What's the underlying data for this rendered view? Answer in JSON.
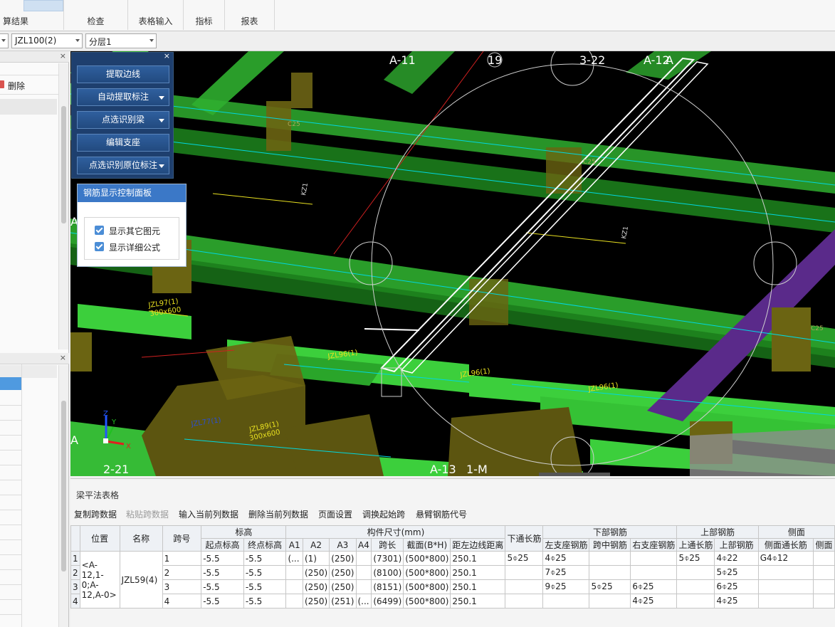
{
  "ribbon": {
    "groups": [
      {
        "label": "算结果",
        "highlight": true
      },
      {
        "label": "检查"
      },
      {
        "label": "表格输入"
      },
      {
        "label": "指标"
      },
      {
        "label": "报表"
      }
    ]
  },
  "selectors": {
    "first_value": "",
    "component": "JZL100(2)",
    "layer": "分层1"
  },
  "left_panel": {
    "close_label": "×",
    "delete_label": "删除"
  },
  "viewport_labels": {
    "a11": "A-11",
    "n19": "19",
    "n322": "3-22",
    "a12": "A-12",
    "a_right": "A",
    "a_left1": "A",
    "a_left2": "A",
    "n221": "2-21",
    "a13": "A-13",
    "m1": "1-M",
    "jzl97": "JZL97(1)",
    "jzl96a": "JZL96(1)",
    "jzl96b": "JZL96(1)",
    "jzl96c": "JZL96(1)",
    "jzl89": "JZL89(1)",
    "jzl77": "JZL77(1)",
    "dim": "300x600",
    "dim2": "300x600",
    "kz": "KZ1",
    "c25": "C25",
    "axis_x": "X",
    "axis_y": "Y",
    "axis_z": "Z"
  },
  "tool_panel": {
    "close_label": "×",
    "buttons": [
      {
        "label": "提取边线",
        "dropdown": false
      },
      {
        "label": "自动提取标注",
        "dropdown": true
      },
      {
        "label": "点选识别梁",
        "dropdown": true
      },
      {
        "label": "编辑支座",
        "dropdown": false
      },
      {
        "label": "点选识别原位标注",
        "dropdown": true
      }
    ]
  },
  "rebar_panel": {
    "title": "钢筋显示控制面板",
    "options": [
      {
        "label": "显示其它图元",
        "checked": true
      },
      {
        "label": "显示详细公式",
        "checked": true
      }
    ]
  },
  "beam_table": {
    "title": "梁平法表格",
    "toolbar": [
      {
        "label": "复制跨数据",
        "enabled": true
      },
      {
        "label": "粘贴跨数据",
        "enabled": false
      },
      {
        "label": "输入当前列数据",
        "enabled": true
      },
      {
        "label": "删除当前列数据",
        "enabled": true
      },
      {
        "label": "页面设置",
        "enabled": true
      },
      {
        "label": "调换起始跨",
        "enabled": true
      },
      {
        "label": "悬臂钢筋代号",
        "enabled": true
      }
    ],
    "group_headers": {
      "position": "位置",
      "name": "名称",
      "span": "跨号",
      "elevation": "标高",
      "dimensions": "构件尺寸(mm)",
      "bottom_through": "下通长筋",
      "bottom_rebar": "下部钢筋",
      "top_rebar": "上部钢筋",
      "side": "侧面"
    },
    "sub_headers": [
      "起点标高",
      "终点标高",
      "A1",
      "A2",
      "A3",
      "A4",
      "跨长",
      "截面(B*H)",
      "距左边线距离",
      "左支座钢筋",
      "跨中钢筋",
      "右支座钢筋",
      "上通长筋",
      "上部钢筋",
      "侧面通长筋",
      "侧面"
    ],
    "position_value": "<A-12,1-0;A-12,A-0>",
    "name_value": "JZL59(4)",
    "rows": [
      {
        "rn": "1",
        "span": "1",
        "start": "-5.5",
        "end": "-5.5",
        "a1": "(...",
        "a2": "(1)",
        "a3": "(250)",
        "a4": "",
        "len": "(7301)",
        "sec": "(500*800)",
        "dist": "250.1",
        "bot_through": "5⌽25",
        "left": "4⌽25",
        "mid": "",
        "right": "",
        "top_through": "5⌽25",
        "top": "4⌽22",
        "side_through": "G4⌽12"
      },
      {
        "rn": "2",
        "span": "2",
        "start": "-5.5",
        "end": "-5.5",
        "a1": "",
        "a2": "(250)",
        "a3": "(250)",
        "a4": "",
        "len": "(8100)",
        "sec": "(500*800)",
        "dist": "250.1",
        "bot_through": "",
        "left": "7⌽25",
        "mid": "",
        "right": "",
        "top_through": "",
        "top": "5⌽25",
        "side_through": ""
      },
      {
        "rn": "3",
        "span": "3",
        "start": "-5.5",
        "end": "-5.5",
        "a1": "",
        "a2": "(250)",
        "a3": "(250)",
        "a4": "",
        "len": "(8151)",
        "sec": "(500*800)",
        "dist": "250.1",
        "bot_through": "",
        "left": "9⌽25",
        "mid": "5⌽25",
        "right": "6⌽25",
        "top_through": "",
        "top": "6⌽25",
        "side_through": ""
      },
      {
        "rn": "4",
        "span": "4",
        "start": "-5.5",
        "end": "-5.5",
        "a1": "",
        "a2": "(250)",
        "a3": "(251)",
        "a4": "(...",
        "len": "(6499)",
        "sec": "(500*800)",
        "dist": "250.1",
        "bot_through": "",
        "left": "",
        "mid": "",
        "right": "4⌽25",
        "top_through": "",
        "top": "4⌽25",
        "side_through": ""
      }
    ]
  },
  "colors": {
    "beam_green": "#2fae2f",
    "column_olive": "#6b6412",
    "purple_beam": "#5a2a8a",
    "panel_blue": "#1e3f6e"
  }
}
